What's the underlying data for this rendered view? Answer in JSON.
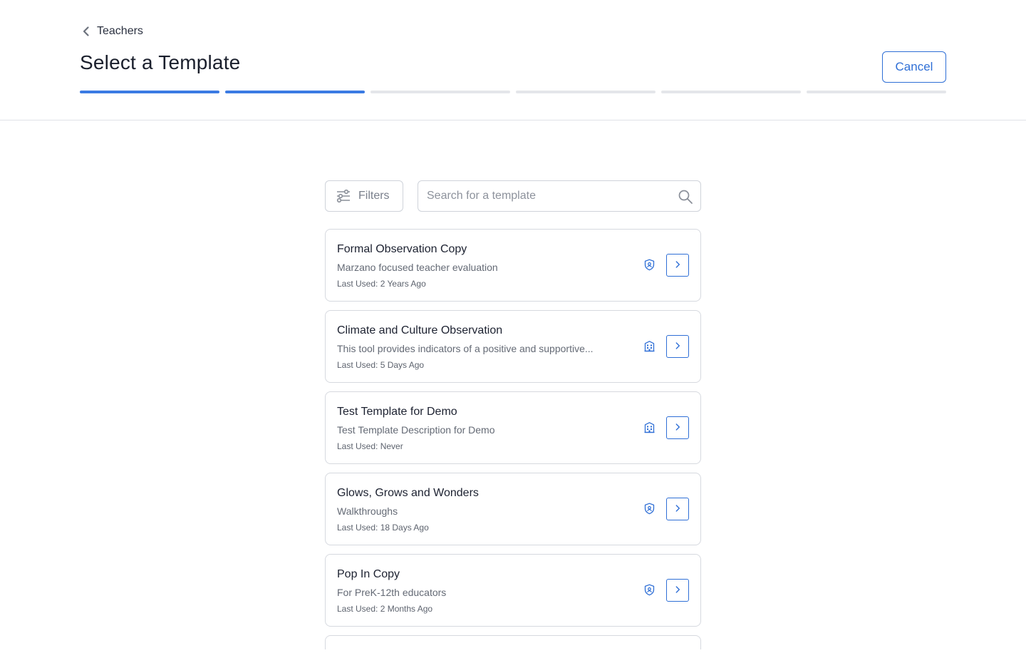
{
  "header": {
    "back_label": "Teachers",
    "title": "Select a Template",
    "cancel_label": "Cancel",
    "progress": {
      "total_steps": 6,
      "completed_steps": 2
    }
  },
  "toolbar": {
    "filters_label": "Filters",
    "search_placeholder": "Search for a template",
    "search_value": ""
  },
  "templates": [
    {
      "name": "Formal Observation Copy",
      "description": "Marzano focused teacher evaluation",
      "last_used": "Last Used: 2 Years Ago",
      "icon": "shield-icon"
    },
    {
      "name": "Climate and Culture Observation",
      "description": "This tool provides indicators of a positive and supportive...",
      "last_used": "Last Used: 5 Days Ago",
      "icon": "building-icon"
    },
    {
      "name": "Test Template for Demo",
      "description": "Test Template Description for Demo",
      "last_used": "Last Used: Never",
      "icon": "building-icon"
    },
    {
      "name": "Glows, Grows and Wonders",
      "description": "Walkthroughs",
      "last_used": "Last Used: 18 Days Ago",
      "icon": "shield-icon"
    },
    {
      "name": "Pop In Copy",
      "description": "For PreK-12th educators",
      "last_used": "Last Used: 2 Months Ago",
      "icon": "shield-icon"
    }
  ],
  "colors": {
    "accent": "#2f6fd6",
    "progress_done": "#3b7be3",
    "progress_todo": "#e4e6ea"
  }
}
